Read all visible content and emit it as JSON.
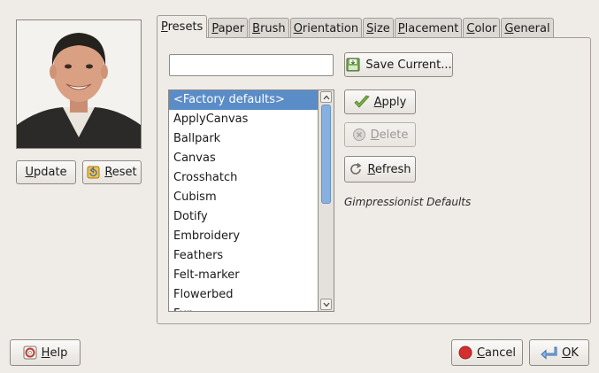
{
  "preview": {
    "update_label": "Update",
    "reset_label": "Reset"
  },
  "tabs": [
    {
      "label": "Presets",
      "active": true
    },
    {
      "label": "Paper",
      "active": false
    },
    {
      "label": "Brush",
      "active": false
    },
    {
      "label": "Orientation",
      "active": false
    },
    {
      "label": "Size",
      "active": false
    },
    {
      "label": "Placement",
      "active": false
    },
    {
      "label": "Color",
      "active": false
    },
    {
      "label": "General",
      "active": false
    }
  ],
  "presets": {
    "name_value": "",
    "name_placeholder": "",
    "save_label": "Save Current...",
    "apply_label": "Apply",
    "delete_label": "Delete",
    "refresh_label": "Refresh",
    "info": "Gimpressionist Defaults",
    "items": [
      "<Factory defaults>",
      "ApplyCanvas",
      "Ballpark",
      "Canvas",
      "Crosshatch",
      "Cubism",
      "Dotify",
      "Embroidery",
      "Feathers",
      "Felt-marker",
      "Flowerbed",
      "Fur"
    ],
    "selected_index": 0
  },
  "footer": {
    "help_label": "Help",
    "cancel_label": "Cancel",
    "ok_label": "OK"
  },
  "colors": {
    "selection": "#5a8cc8",
    "window_bg": "#efebe7"
  }
}
